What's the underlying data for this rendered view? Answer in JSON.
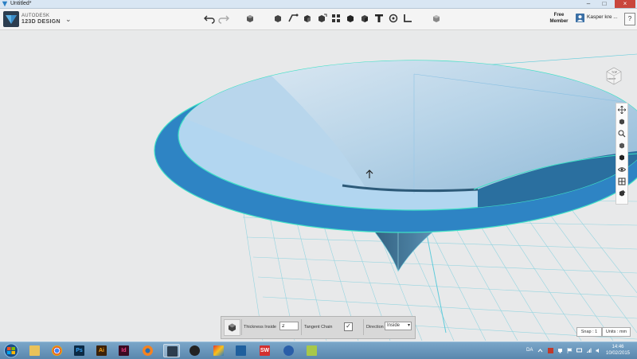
{
  "window": {
    "title": "Untitled*"
  },
  "brand": {
    "line1": "AUTODESK",
    "line2": "123D DESIGN"
  },
  "account": {
    "member_line1": "Free",
    "member_line2": "Member",
    "user_name": "Kasper kre ...",
    "help_label": "?"
  },
  "toolbar_icons": [
    "undo-icon",
    "redo-icon",
    "primitives-icon",
    "sketch-icon",
    "construct-icon",
    "modify-icon",
    "pattern-icon",
    "group-icon",
    "combine-icon",
    "text-icon",
    "snap-icon",
    "measure-icon",
    "material-icon"
  ],
  "shell_panel": {
    "thickness_label": "Thickness  Inside",
    "thickness_value": "2",
    "tangent_chain_label": "Tangent Chain",
    "tangent_chain_checked": true,
    "direction_label": "Direction",
    "direction_value": "Inside"
  },
  "status": {
    "snap_label": "Snap : 1",
    "units_label": "Units : mm"
  },
  "viewcube": {
    "face_top": "TOP",
    "face_front": "FRONT"
  },
  "taskbar": {
    "apps": [
      {
        "name": "explorer",
        "label": ""
      },
      {
        "name": "chrome",
        "label": ""
      },
      {
        "name": "photoshop",
        "label": "Ps"
      },
      {
        "name": "illustrator",
        "label": "Ai"
      },
      {
        "name": "indesign",
        "label": "Id"
      },
      {
        "name": "blender",
        "label": ""
      },
      {
        "name": "123d-design",
        "label": ""
      },
      {
        "name": "inkscape",
        "label": ""
      },
      {
        "name": "sketchup",
        "label": ""
      },
      {
        "name": "virtualbox",
        "label": ""
      },
      {
        "name": "solidworks",
        "label": "SW"
      },
      {
        "name": "settings",
        "label": ""
      },
      {
        "name": "notepad",
        "label": ""
      }
    ],
    "lang": "DA",
    "time": "14:46",
    "date": "10/02/2015"
  },
  "colors": {
    "accent": "#2e84c4",
    "accent_light": "#a9d2ee",
    "edge_highlight": "#38e0c8",
    "grid": "#7fd3e0",
    "background": "#e8e9ea"
  }
}
